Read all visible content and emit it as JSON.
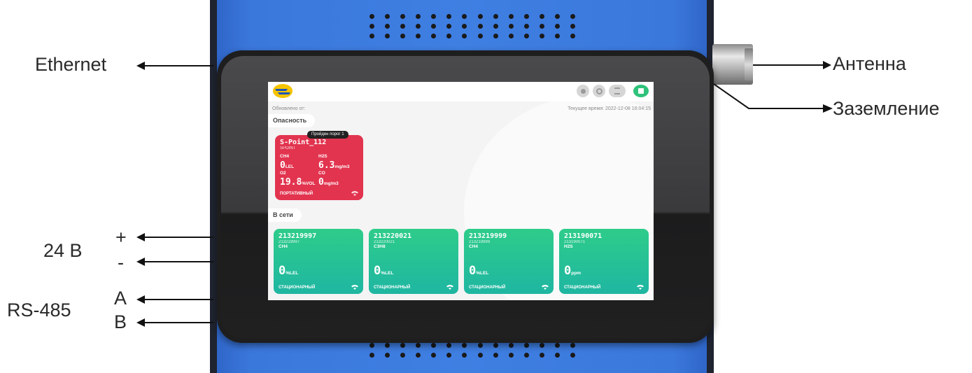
{
  "callouts": {
    "ethernet": "Ethernet",
    "antenna": "Антенна",
    "ground": "Заземление",
    "power": "24 В",
    "plus": "+",
    "minus": "-",
    "rs485": "RS-485",
    "a": "A",
    "b": "B"
  },
  "screen": {
    "updated_label": "Обновлено от:",
    "current_time": "Текущее время:  2022-12-08 16:04:15",
    "danger_section": "Опасность",
    "online_section": "В сети",
    "danger_card": {
      "badge": "Пройден порог 1",
      "title": "S-Point_112",
      "subtitle": "SPOINT",
      "readings": [
        {
          "gas": "CH4",
          "value": "0",
          "unit": "LEL"
        },
        {
          "gas": "H2S",
          "value": "6.3",
          "unit": "mg/m3"
        },
        {
          "gas": "O2",
          "value": "19.8",
          "unit": "%VOL"
        },
        {
          "gas": "CO",
          "value": "0",
          "unit": "mg/m3"
        }
      ],
      "type": "ПОРТАТИВНЫЙ"
    },
    "online_cards": [
      {
        "title": "213219997",
        "subtitle": "213219997",
        "gas": "CH4",
        "value": "0",
        "unit": "%LEL",
        "type": "СТАЦИОНАРНЫЙ"
      },
      {
        "title": "213220021",
        "subtitle": "213220021",
        "gas": "C3H8",
        "value": "0",
        "unit": "%LEL",
        "type": "СТАЦИОНАРНЫЙ"
      },
      {
        "title": "213219999",
        "subtitle": "213219999",
        "gas": "CH4",
        "value": "0",
        "unit": "%LEL",
        "type": "СТАЦИОНАРНЫЙ"
      },
      {
        "title": "213190071",
        "subtitle": "213190071",
        "gas": "H2S",
        "value": "0",
        "unit": "ppm",
        "type": "СТАЦИОНАРНЫЙ"
      }
    ]
  },
  "colors": {
    "device_blue": "#3b78dc",
    "danger_red": "#e2344f",
    "online_green": "#2ecc8a"
  }
}
